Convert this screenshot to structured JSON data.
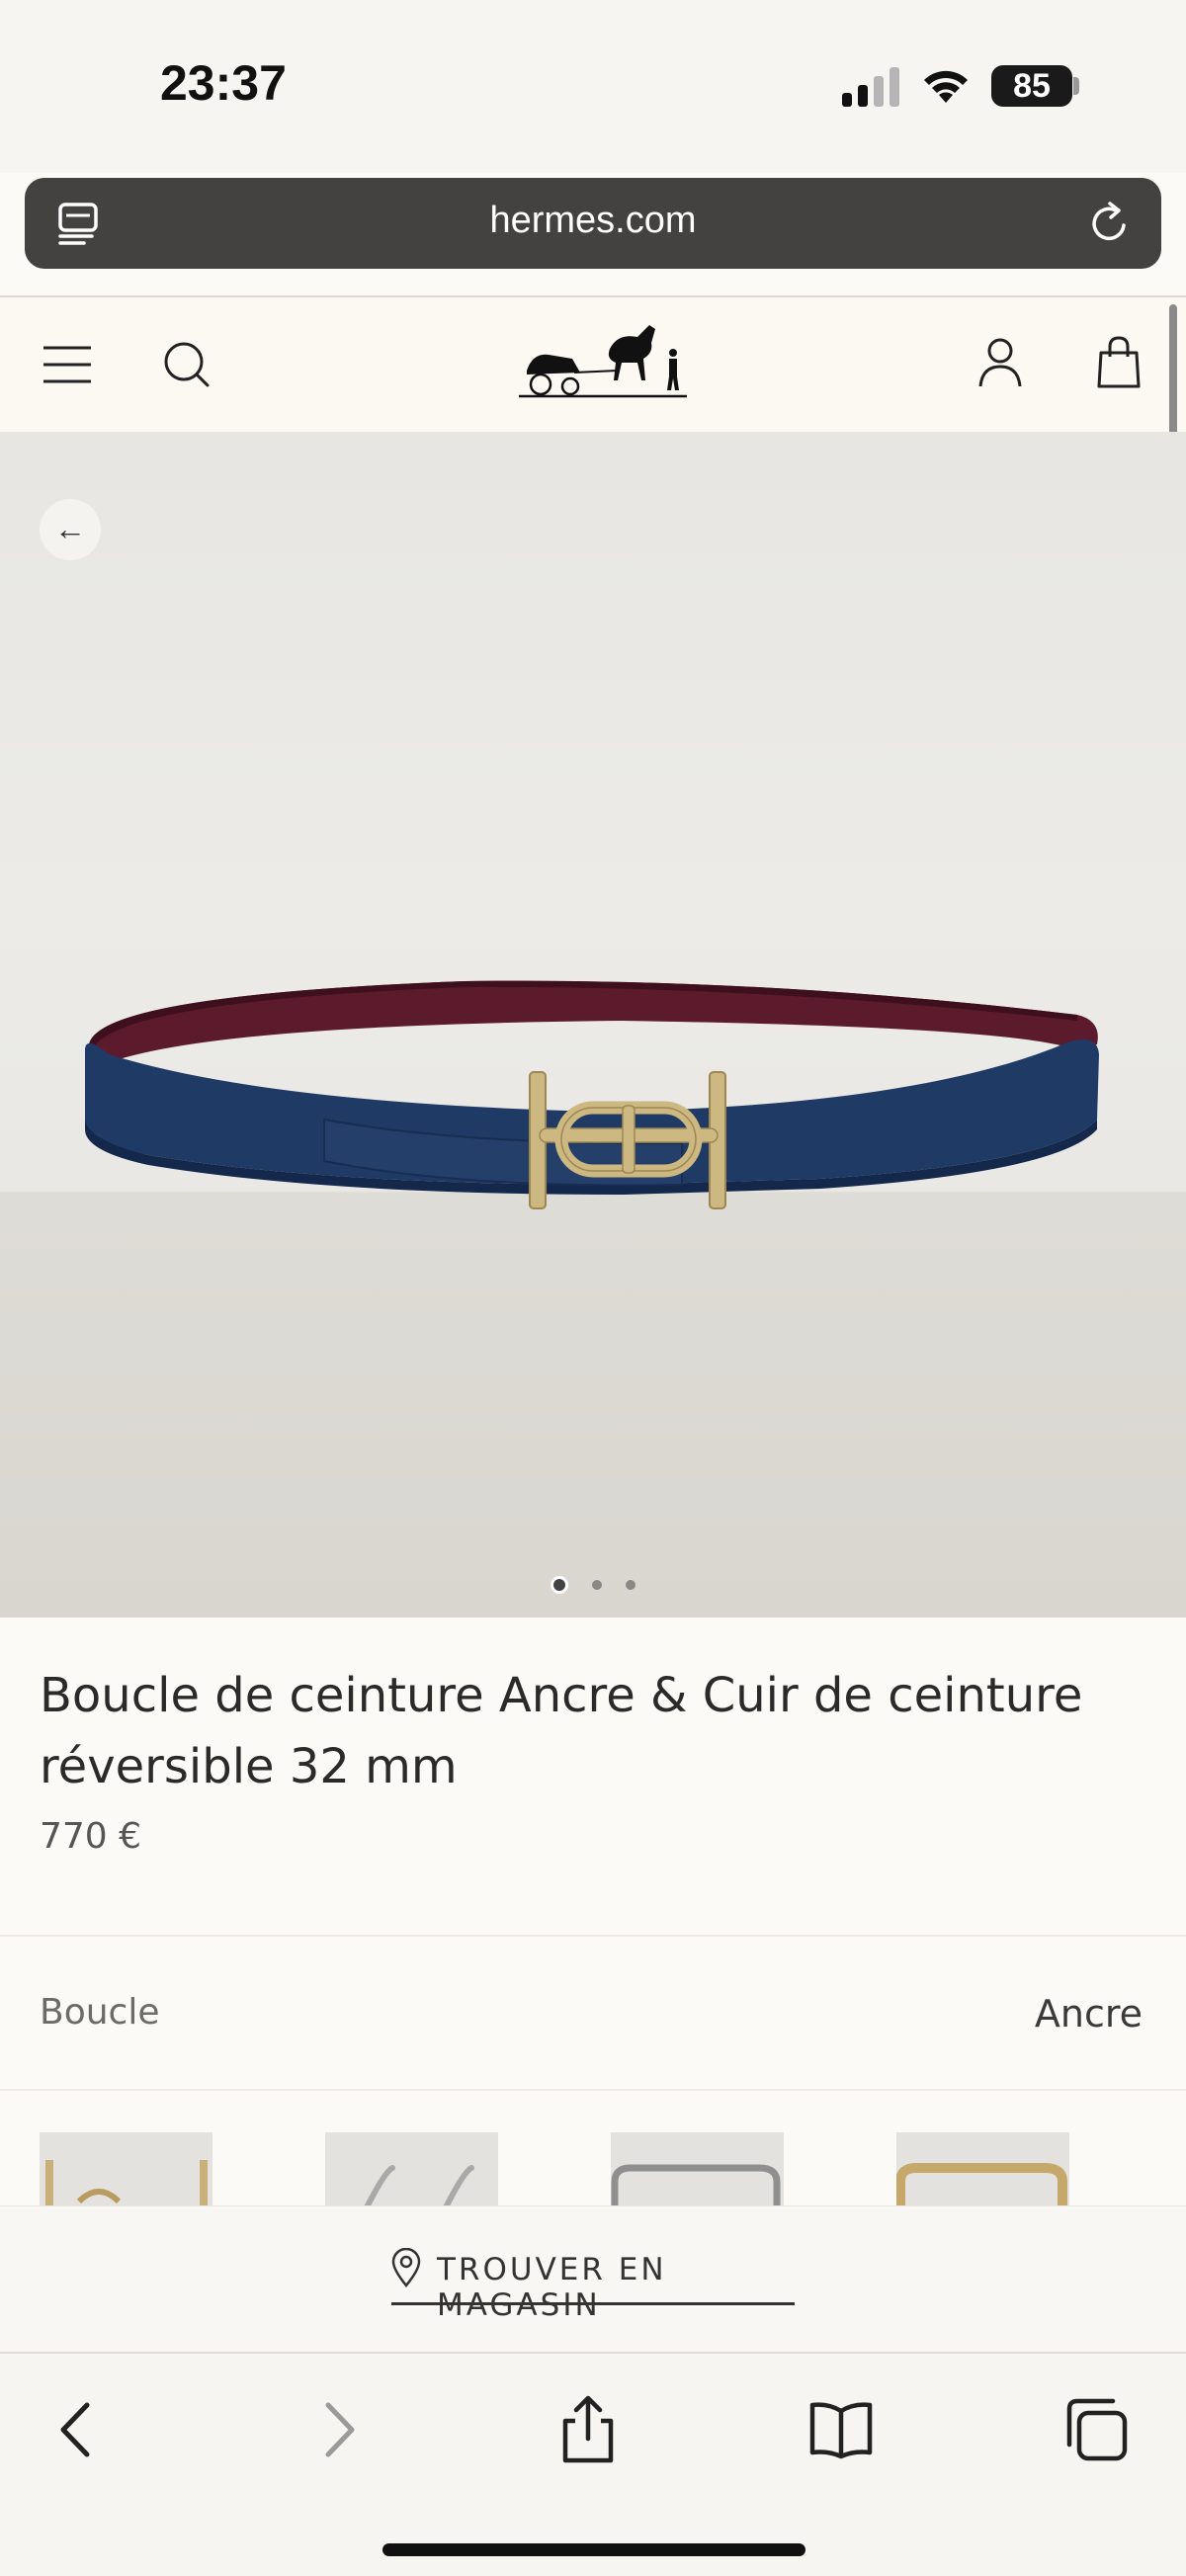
{
  "status_bar": {
    "time": "23:37",
    "battery": "85"
  },
  "browser": {
    "url": "hermes.com"
  },
  "product": {
    "title": "Boucle de ceinture Ancre & Cuir de ceinture réversible 32 mm",
    "price": "770 €",
    "image_pages": 3,
    "image_current": 1
  },
  "options": {
    "label": "Boucle",
    "value": "Ancre"
  },
  "store": {
    "label": "TROUVER EN MAGASIN"
  },
  "colors": {
    "belt_blue": "#1f3a64",
    "belt_burgundy": "#5a1a2a",
    "buckle_gold": "#cdb882",
    "page_bg": "#fcfaf6"
  }
}
